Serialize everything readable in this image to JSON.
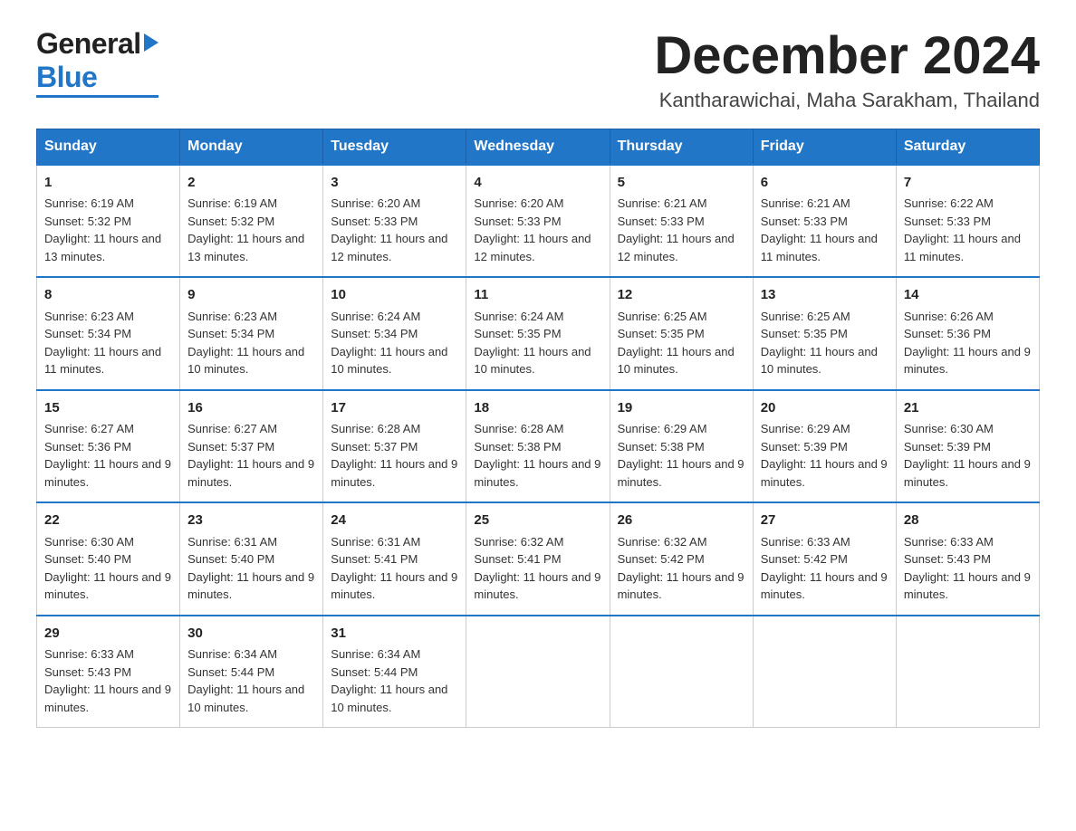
{
  "header": {
    "logo_general": "General",
    "logo_blue": "Blue",
    "month_title": "December 2024",
    "location": "Kantharawichai, Maha Sarakham, Thailand"
  },
  "weekdays": [
    "Sunday",
    "Monday",
    "Tuesday",
    "Wednesday",
    "Thursday",
    "Friday",
    "Saturday"
  ],
  "weeks": [
    [
      {
        "day": "1",
        "sunrise": "6:19 AM",
        "sunset": "5:32 PM",
        "daylight": "11 hours and 13 minutes."
      },
      {
        "day": "2",
        "sunrise": "6:19 AM",
        "sunset": "5:32 PM",
        "daylight": "11 hours and 13 minutes."
      },
      {
        "day": "3",
        "sunrise": "6:20 AM",
        "sunset": "5:33 PM",
        "daylight": "11 hours and 12 minutes."
      },
      {
        "day": "4",
        "sunrise": "6:20 AM",
        "sunset": "5:33 PM",
        "daylight": "11 hours and 12 minutes."
      },
      {
        "day": "5",
        "sunrise": "6:21 AM",
        "sunset": "5:33 PM",
        "daylight": "11 hours and 12 minutes."
      },
      {
        "day": "6",
        "sunrise": "6:21 AM",
        "sunset": "5:33 PM",
        "daylight": "11 hours and 11 minutes."
      },
      {
        "day": "7",
        "sunrise": "6:22 AM",
        "sunset": "5:33 PM",
        "daylight": "11 hours and 11 minutes."
      }
    ],
    [
      {
        "day": "8",
        "sunrise": "6:23 AM",
        "sunset": "5:34 PM",
        "daylight": "11 hours and 11 minutes."
      },
      {
        "day": "9",
        "sunrise": "6:23 AM",
        "sunset": "5:34 PM",
        "daylight": "11 hours and 10 minutes."
      },
      {
        "day": "10",
        "sunrise": "6:24 AM",
        "sunset": "5:34 PM",
        "daylight": "11 hours and 10 minutes."
      },
      {
        "day": "11",
        "sunrise": "6:24 AM",
        "sunset": "5:35 PM",
        "daylight": "11 hours and 10 minutes."
      },
      {
        "day": "12",
        "sunrise": "6:25 AM",
        "sunset": "5:35 PM",
        "daylight": "11 hours and 10 minutes."
      },
      {
        "day": "13",
        "sunrise": "6:25 AM",
        "sunset": "5:35 PM",
        "daylight": "11 hours and 10 minutes."
      },
      {
        "day": "14",
        "sunrise": "6:26 AM",
        "sunset": "5:36 PM",
        "daylight": "11 hours and 9 minutes."
      }
    ],
    [
      {
        "day": "15",
        "sunrise": "6:27 AM",
        "sunset": "5:36 PM",
        "daylight": "11 hours and 9 minutes."
      },
      {
        "day": "16",
        "sunrise": "6:27 AM",
        "sunset": "5:37 PM",
        "daylight": "11 hours and 9 minutes."
      },
      {
        "day": "17",
        "sunrise": "6:28 AM",
        "sunset": "5:37 PM",
        "daylight": "11 hours and 9 minutes."
      },
      {
        "day": "18",
        "sunrise": "6:28 AM",
        "sunset": "5:38 PM",
        "daylight": "11 hours and 9 minutes."
      },
      {
        "day": "19",
        "sunrise": "6:29 AM",
        "sunset": "5:38 PM",
        "daylight": "11 hours and 9 minutes."
      },
      {
        "day": "20",
        "sunrise": "6:29 AM",
        "sunset": "5:39 PM",
        "daylight": "11 hours and 9 minutes."
      },
      {
        "day": "21",
        "sunrise": "6:30 AM",
        "sunset": "5:39 PM",
        "daylight": "11 hours and 9 minutes."
      }
    ],
    [
      {
        "day": "22",
        "sunrise": "6:30 AM",
        "sunset": "5:40 PM",
        "daylight": "11 hours and 9 minutes."
      },
      {
        "day": "23",
        "sunrise": "6:31 AM",
        "sunset": "5:40 PM",
        "daylight": "11 hours and 9 minutes."
      },
      {
        "day": "24",
        "sunrise": "6:31 AM",
        "sunset": "5:41 PM",
        "daylight": "11 hours and 9 minutes."
      },
      {
        "day": "25",
        "sunrise": "6:32 AM",
        "sunset": "5:41 PM",
        "daylight": "11 hours and 9 minutes."
      },
      {
        "day": "26",
        "sunrise": "6:32 AM",
        "sunset": "5:42 PM",
        "daylight": "11 hours and 9 minutes."
      },
      {
        "day": "27",
        "sunrise": "6:33 AM",
        "sunset": "5:42 PM",
        "daylight": "11 hours and 9 minutes."
      },
      {
        "day": "28",
        "sunrise": "6:33 AM",
        "sunset": "5:43 PM",
        "daylight": "11 hours and 9 minutes."
      }
    ],
    [
      {
        "day": "29",
        "sunrise": "6:33 AM",
        "sunset": "5:43 PM",
        "daylight": "11 hours and 9 minutes."
      },
      {
        "day": "30",
        "sunrise": "6:34 AM",
        "sunset": "5:44 PM",
        "daylight": "11 hours and 10 minutes."
      },
      {
        "day": "31",
        "sunrise": "6:34 AM",
        "sunset": "5:44 PM",
        "daylight": "11 hours and 10 minutes."
      },
      null,
      null,
      null,
      null
    ]
  ],
  "labels": {
    "sunrise": "Sunrise:",
    "sunset": "Sunset:",
    "daylight": "Daylight:"
  },
  "colors": {
    "header_bg": "#2176c7",
    "header_text": "#ffffff",
    "border": "#aaaaaa",
    "cell_border": "#cccccc",
    "week_border": "#2176c7"
  }
}
